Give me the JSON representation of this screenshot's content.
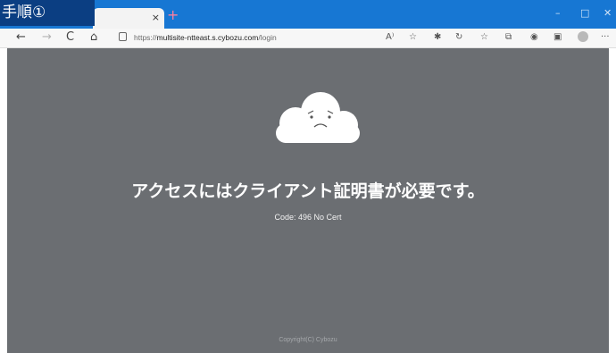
{
  "overlay": {
    "step_label": "手順①"
  },
  "browser": {
    "tab_close": "×",
    "new_tab": "+",
    "window_controls": {
      "minimize": "–",
      "maximize": "□",
      "close": "✕"
    },
    "nav": {
      "back": "←",
      "forward": "→",
      "reload": "C",
      "home": "⌂"
    },
    "url_prefix": "https://",
    "url_host": "multisite-ntteast.s.cybozu.com",
    "url_path": "/login",
    "toolbar_icons": {
      "read_aloud": "A⁾",
      "favorite_add": "☆",
      "extensions": "✱",
      "refresh_page": "↻",
      "favorites": "☆",
      "collections": "⧉",
      "account": "◉",
      "wallet": "▣",
      "more": "···"
    }
  },
  "error_page": {
    "cloud_icon": "sad-cloud-icon",
    "message": "アクセスにはクライアント証明書が必要です。",
    "code": "Code: 496 No Cert",
    "copyright": "Copyright(C) Cybozu"
  },
  "colors": {
    "titlebar": "#1777d3",
    "background": "#6b6e72",
    "step_label_bg": "#0b3e82"
  }
}
